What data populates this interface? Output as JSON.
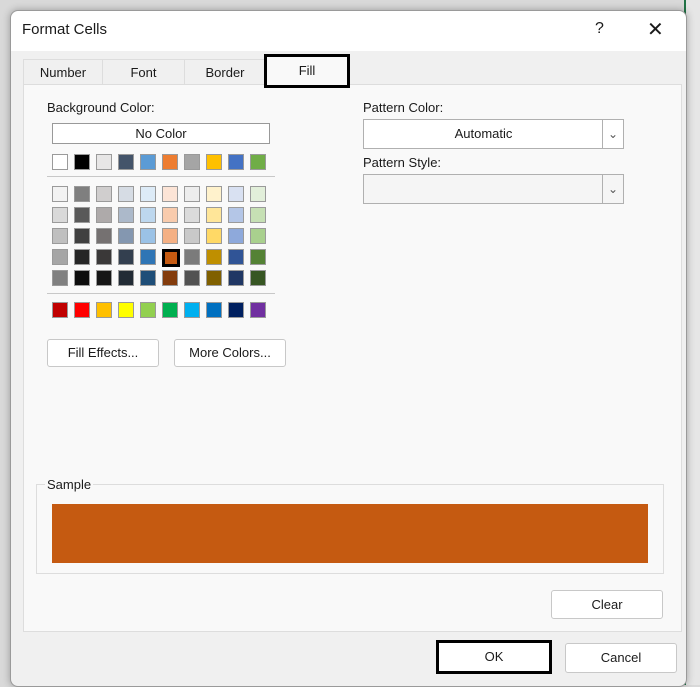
{
  "dialog": {
    "title": "Format Cells",
    "help": "?",
    "close": "✕"
  },
  "tabs": [
    {
      "label": "Number"
    },
    {
      "label": "Font"
    },
    {
      "label": "Border"
    },
    {
      "label": "Fill"
    }
  ],
  "background": {
    "label": "Background Color:",
    "no_color": "No Color",
    "selected_color": "#C55A11",
    "theme_top": [
      "#FFFFFF",
      "#000000",
      "#E7E6E6",
      "#44546A",
      "#5B9BD5",
      "#ED7D31",
      "#A5A5A5",
      "#FFC000",
      "#4472C4",
      "#70AD47"
    ],
    "theme_shades": [
      [
        "#F2F2F2",
        "#7F7F7F",
        "#D0CECE",
        "#D6DCE4",
        "#DDEBF7",
        "#FCE4D6",
        "#EDEDED",
        "#FFF2CC",
        "#D9E1F2",
        "#E2EFDA"
      ],
      [
        "#D9D9D9",
        "#595959",
        "#AEAAAA",
        "#ACB9CA",
        "#BDD7EE",
        "#F8CBAD",
        "#DBDBDB",
        "#FFE699",
        "#B4C6E7",
        "#C6E0B4"
      ],
      [
        "#BFBFBF",
        "#404040",
        "#757171",
        "#8497B0",
        "#9BC2E6",
        "#F4B084",
        "#C9C9C9",
        "#FFD966",
        "#8EA9DB",
        "#A9D08E"
      ],
      [
        "#A6A6A6",
        "#262626",
        "#3A3838",
        "#333F4F",
        "#2F75B5",
        "#C55A11",
        "#7B7B7B",
        "#BF8F00",
        "#305496",
        "#548235"
      ],
      [
        "#808080",
        "#0D0D0D",
        "#161616",
        "#222B35",
        "#1F4E78",
        "#833C0C",
        "#525252",
        "#806000",
        "#203764",
        "#375623"
      ]
    ],
    "standard": [
      "#C00000",
      "#FF0000",
      "#FFC000",
      "#FFFF00",
      "#92D050",
      "#00B050",
      "#00B0F0",
      "#0070C0",
      "#002060",
      "#7030A0"
    ],
    "fill_effects": "Fill Effects...",
    "more_colors": "More Colors..."
  },
  "pattern": {
    "color_label": "Pattern Color:",
    "color_value": "Automatic",
    "style_label": "Pattern Style:",
    "style_value": ""
  },
  "sample": {
    "label": "Sample",
    "color": "#C55A11"
  },
  "buttons": {
    "clear": "Clear",
    "ok": "OK",
    "cancel": "Cancel"
  }
}
